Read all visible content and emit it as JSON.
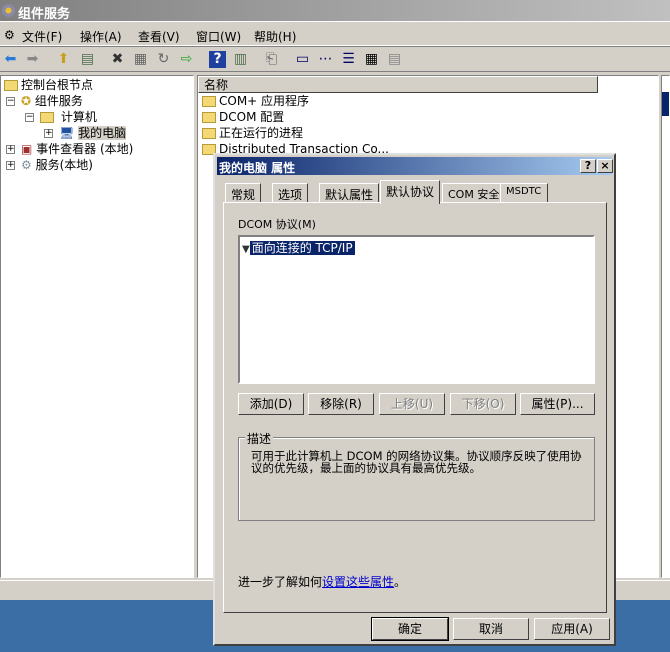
{
  "app": {
    "title": "组件服务"
  },
  "menu": [
    "文件(F)",
    "操作(A)",
    "查看(V)",
    "窗口(W)",
    "帮助(H)"
  ],
  "toolbar_icons": [
    "back-icon",
    "forward-icon",
    "up-icon",
    "show-tree-icon",
    "delete-icon",
    "properties-icon",
    "refresh-icon",
    "export-icon",
    "help-icon",
    "view-icon",
    "new-icon",
    "large-icons-icon",
    "small-icons-icon",
    "list-icon",
    "details-icon",
    "columns-icon"
  ],
  "tree": {
    "root": "控制台根节点",
    "component_services": "组件服务",
    "computers": "计算机",
    "my_computer": "我的电脑",
    "event_viewer": "事件查看器 (本地)",
    "services": "服务(本地)"
  },
  "list": {
    "column": "名称",
    "items": [
      "COM+ 应用程序",
      "DCOM 配置",
      "正在运行的进程",
      "Distributed Transaction Co..."
    ]
  },
  "dialog": {
    "title": "我的电脑 属性",
    "help": "?",
    "close": "×",
    "tabs": [
      "常规",
      "选项",
      "默认属性",
      "默认协议",
      "COM 安全",
      "MSDTC"
    ],
    "active_tab": "默认协议",
    "protocols_label": "DCOM 协议(M)",
    "protocols": [
      "面向连接的 TCP/IP"
    ],
    "buttons": {
      "add": "添加(D)",
      "remove": "移除(R)",
      "up": "上移(U)",
      "down": "下移(O)",
      "properties": "属性(P)..."
    },
    "description_label": "描述",
    "description": "可用于此计算机上 DCOM 的网络协议集。协议顺序反映了使用协议的优先级，最上面的协议具有最高优先级。",
    "learn_prefix": "进一步了解如何",
    "learn_link": "设置这些属性",
    "learn_suffix": "。",
    "ok": "确定",
    "cancel": "取消",
    "apply": "应用(A)"
  },
  "colors": {
    "desktop": "#3a6ea5",
    "selection": "#0a246a"
  }
}
